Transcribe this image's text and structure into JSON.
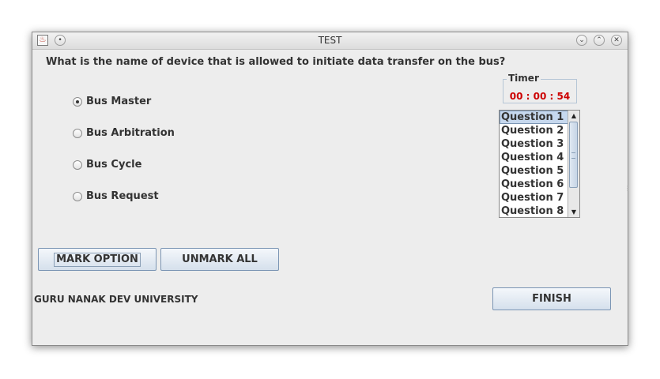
{
  "window": {
    "title": "TEST"
  },
  "question": {
    "text": "What is the name of device that is allowed to initiate data transfer on the bus?"
  },
  "options": [
    {
      "label": "Bus Master",
      "selected": true
    },
    {
      "label": "Bus Arbitration",
      "selected": false
    },
    {
      "label": "Bus Cycle",
      "selected": false
    },
    {
      "label": "Bus Request",
      "selected": false
    }
  ],
  "timer": {
    "title": "Timer",
    "value": "00 : 00 : 54",
    "color": "#cc0000"
  },
  "question_list": {
    "items": [
      "Question 1",
      "Question 2",
      "Question 3",
      "Question 4",
      "Question 5",
      "Question 6",
      "Question 7",
      "Question 8"
    ],
    "selected_index": 0
  },
  "buttons": {
    "mark": "MARK OPTION",
    "unmark": "UNMARK ALL",
    "finish": "FINISH"
  },
  "footer": {
    "text": "GURU NANAK DEV UNIVERSITY"
  },
  "icons": {
    "app": "java-app-icon",
    "menu": "window-menu-icon",
    "minimize": "minimize-icon",
    "maximize": "maximize-icon",
    "close": "close-icon"
  }
}
